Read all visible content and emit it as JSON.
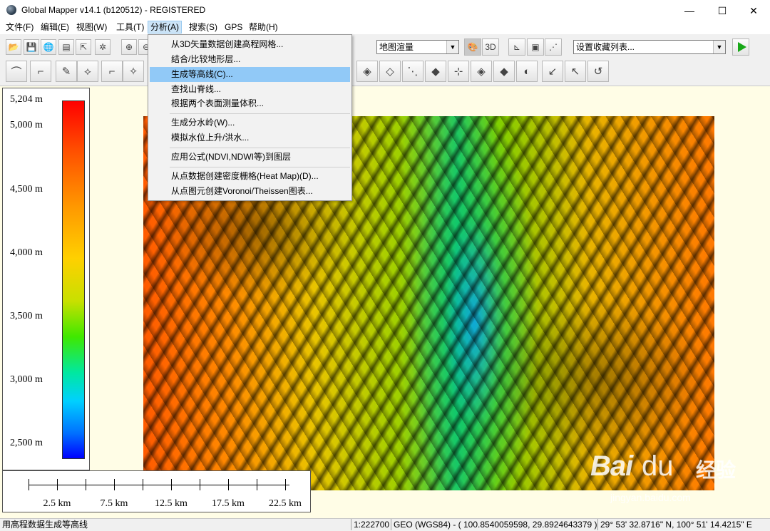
{
  "window": {
    "title": "Global Mapper v14.1 (b120512) - REGISTERED",
    "minimize": "—",
    "maximize": "☐",
    "close": "✕"
  },
  "menubar": {
    "items": [
      "文件(F)",
      "编辑(E)",
      "视图(W)",
      "工具(T)",
      "分析(A)",
      "搜索(S)",
      "GPS",
      "帮助(H)"
    ],
    "active": "分析(A)"
  },
  "analysis_menu": {
    "items": [
      "从3D矢量数据创建高程网格...",
      "结合/比较地形层...",
      "生成等高线(C)...",
      "查找山脊线...",
      "根据两个表面测量体积...",
      "生成分水岭(W)...",
      "模拟水位上升/洪水...",
      "应用公式(NDVI,NDWI等)到图层",
      "从点数据创建密度栅格(Heat Map)(D)...",
      "从点图元创建Voronoi/Theissen图表..."
    ],
    "highlighted": "生成等高线(C)..."
  },
  "toolbar": {
    "render_mode_value": "地图渲量",
    "favorites_value": "设置收藏列表..."
  },
  "legend": {
    "labels": [
      "5,204 m",
      "5,000 m",
      "4,500 m",
      "4,000 m",
      "3,500 m",
      "3,000 m",
      "2,500 m"
    ]
  },
  "scale": {
    "labels": [
      "2.5 km",
      "7.5 km",
      "12.5 km",
      "17.5 km",
      "22.5 km"
    ]
  },
  "watermark": {
    "logo": "Bai",
    "paw": "du",
    "cn": "经验",
    "url": "jingyan.baidu.com"
  },
  "statusbar": {
    "message": "用高程数据生成等高线",
    "scale": "1:222700",
    "coords": "GEO (WGS84) - ( 100.8540059598, 29.8924643379 )",
    "dms": "29° 53' 32.8716\" N, 100° 51' 14.4215\" E"
  },
  "colors": {
    "accent_highlight": "#91c9f7",
    "map_background": "#fffde6"
  }
}
